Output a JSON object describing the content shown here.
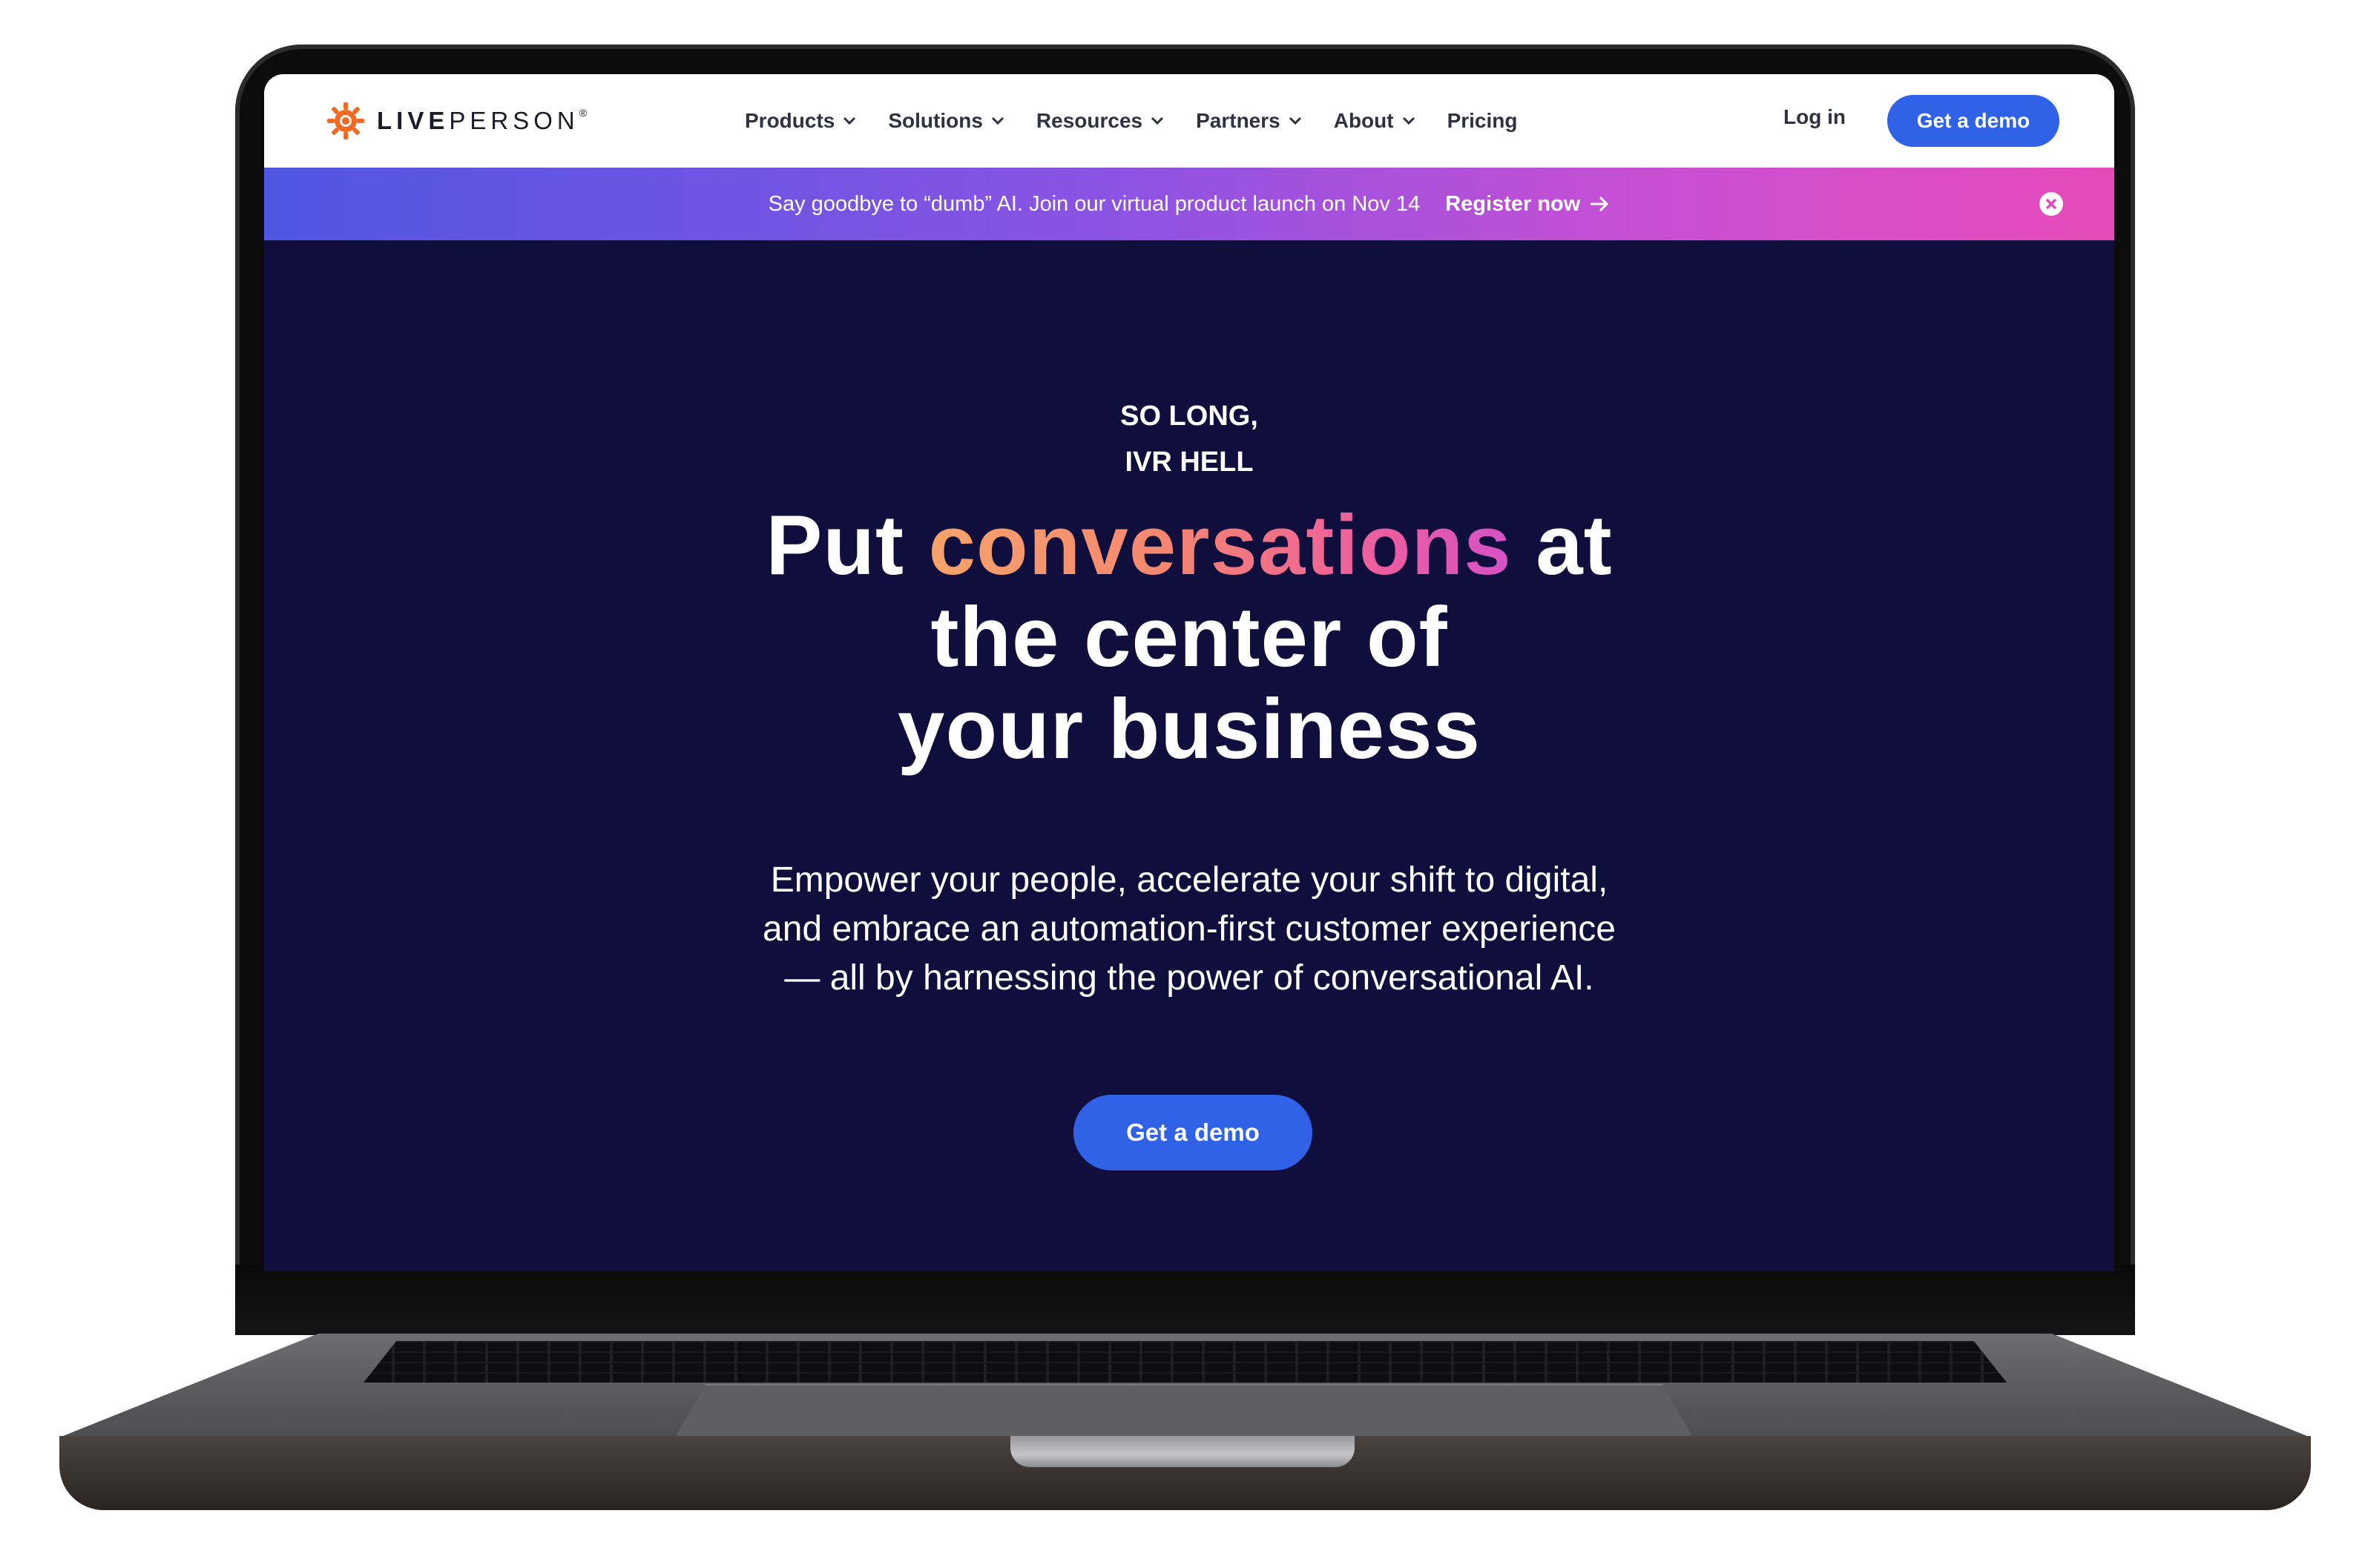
{
  "brand": {
    "name_bold": "LIVE",
    "name_rest": "PERSON",
    "registered": "®",
    "accent": "#f26a21"
  },
  "nav": {
    "items": [
      {
        "label": "Products",
        "has_dropdown": true
      },
      {
        "label": "Solutions",
        "has_dropdown": true
      },
      {
        "label": "Resources",
        "has_dropdown": true
      },
      {
        "label": "Partners",
        "has_dropdown": true
      },
      {
        "label": "About",
        "has_dropdown": true
      },
      {
        "label": "Pricing",
        "has_dropdown": false
      }
    ],
    "login_label": "Log in",
    "cta_label": "Get a demo",
    "cta_color": "#2f62e6"
  },
  "banner": {
    "text": "Say goodbye to “dumb” AI. Join our virtual product launch on Nov 14",
    "link_label": "Register now",
    "link_icon": "arrow-right-icon",
    "close_icon": "close-circle-icon"
  },
  "hero": {
    "eyebrow_line1": "SO LONG,",
    "eyebrow_line2": "IVR HELL",
    "headline_pre": "Put ",
    "headline_highlight": "conversations",
    "headline_post": " at",
    "headline_line2": "the center of",
    "headline_line3": "your business",
    "sub_line1": "Empower your people, accelerate your shift to digital,",
    "sub_line2": "and embrace an automation-first customer experience",
    "sub_line3": "— all by harnessing the power of conversational AI.",
    "cta_label": "Get a demo",
    "background": "#0f0e3c"
  }
}
